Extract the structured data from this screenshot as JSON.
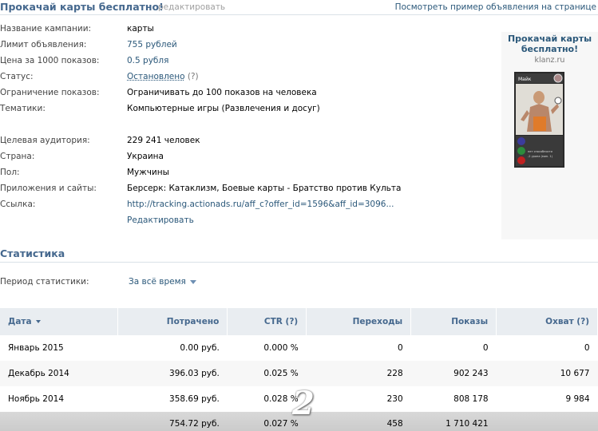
{
  "header": {
    "campaign_title": "Прокачай карты бесплатно!",
    "edit_link": "редактировать",
    "example_link": "Посмотреть пример объявления на странице"
  },
  "info": {
    "campaign_name_label": "Название кампании:",
    "campaign_name_value": "карты",
    "limit_label": "Лимит объявления:",
    "limit_value": "755 рублей",
    "price_label": "Цена за 1000 показов:",
    "price_value": "0.5 рубля",
    "status_label": "Статус:",
    "status_value": "Остановлено",
    "status_help": "(?)",
    "limit_views_label": "Ограничение показов:",
    "limit_views_value": "Ограничивать до 100 показов на человека",
    "topics_label": "Тематики:",
    "topics_value": "Компьютерные игры (Развлечения и досуг)",
    "audience_label": "Целевая аудитория:",
    "audience_value": "229 241 человек",
    "country_label": "Страна:",
    "country_value": "Украина",
    "gender_label": "Пол:",
    "gender_value": "Мужчины",
    "apps_label": "Приложения и сайты:",
    "apps_value": "Берсерк: Катаклизм, Боевые карты - Братство против Культа",
    "link_label": "Ссылка:",
    "link_value": "http://tracking.actionads.ru/aff_c?offer_id=1596&aff_id=3096...",
    "edit_label": "Редактировать"
  },
  "preview": {
    "title": "Прокачай карты бесплатно!",
    "domain": "klanz.ru",
    "card_name": "Майк",
    "card_text_1": "нет способности",
    "card_text_2": "-2 урона (мин. 1)"
  },
  "stats": {
    "title": "Статистика",
    "period_label": "Период статистики:",
    "period_value": "За всё время",
    "columns": [
      "Дата",
      "Потрачено",
      "CTR (?)",
      "Переходы",
      "Показы",
      "Охват (?)"
    ],
    "rows": [
      [
        "Январь 2015",
        "0.00 руб.",
        "0.000 %",
        "0",
        "0",
        "0"
      ],
      [
        "Декабрь 2014",
        "396.03 руб.",
        "0.025 %",
        "228",
        "902 243",
        "10 677"
      ],
      [
        "Ноябрь 2014",
        "358.69 руб.",
        "0.028 %",
        "230",
        "808 178",
        "9 984"
      ]
    ],
    "total": [
      "",
      "754.72 руб.",
      "0.027 %",
      "458",
      "1 710 421",
      ""
    ]
  },
  "watermark": "2"
}
